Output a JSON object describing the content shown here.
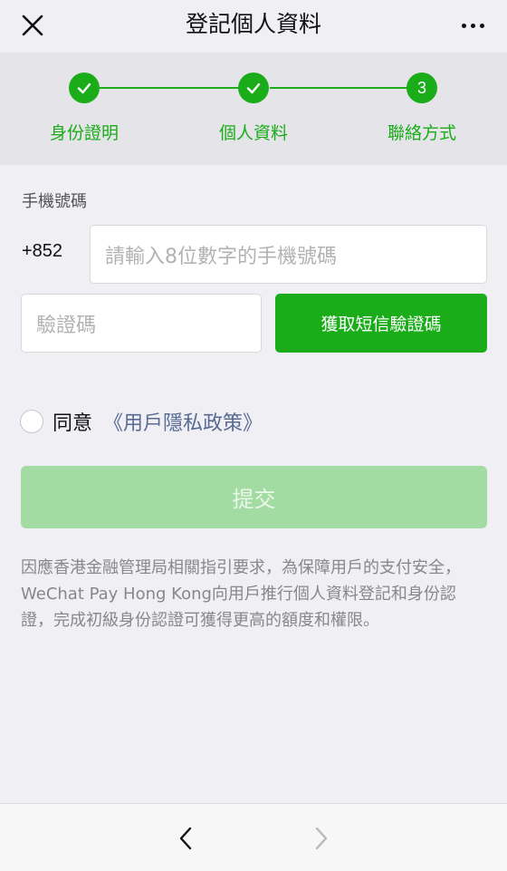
{
  "header": {
    "title": "登記個人資料",
    "close_icon": "close-icon",
    "more_icon": "more-icon"
  },
  "stepper": {
    "steps": [
      {
        "label": "身份證明",
        "status": "done"
      },
      {
        "label": "個人資料",
        "status": "done"
      },
      {
        "label": "聯絡方式",
        "status": "current",
        "number": "3"
      }
    ],
    "accent_color": "#1aad19"
  },
  "form": {
    "phone_label": "手機號碼",
    "country_code": "+852",
    "phone_placeholder": "請輸入8位數字的手機號碼",
    "code_placeholder": "驗證碼",
    "get_code_label": "獲取短信驗證碼",
    "agree_label": "同意",
    "policy_link": "《用戶隱私政策》",
    "submit_label": "提交"
  },
  "notice": "因應香港金融管理局相關指引要求，為保障用戶的支付安全，WeChat Pay Hong Kong向用戶推行個人資料登記和身份認證，完成初級身份認證可獲得更高的額度和權限。",
  "bottom_nav": {
    "back_icon": "chevron-left-icon",
    "forward_icon": "chevron-right-icon"
  }
}
